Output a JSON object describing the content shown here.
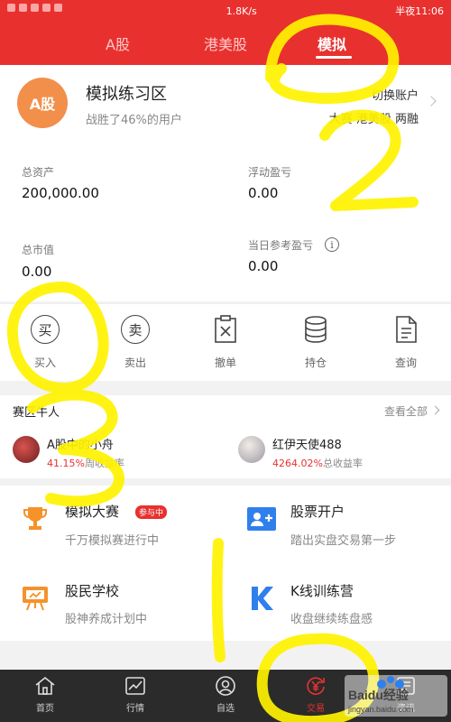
{
  "status_bar": {
    "speed": "1.8K/s",
    "time_text": "半夜11:06"
  },
  "top_tabs": [
    {
      "label": "A股"
    },
    {
      "label": "港美股"
    },
    {
      "label": "模拟"
    }
  ],
  "account": {
    "avatar_text": "A股",
    "title": "模拟练习区",
    "subtitle": "战胜了46%的用户",
    "switch_line1": "切换账户",
    "switch_line2": "大赛 港美股 两融",
    "total_assets_label": "总资产",
    "total_assets_value": "200,000.00",
    "floating_pl_label": "浮动盈亏",
    "floating_pl_value": "0.00",
    "market_value_label": "总市值",
    "market_value_value": "0.00",
    "today_pl_label": "当日参考盈亏",
    "today_pl_value": "0.00"
  },
  "actions": [
    {
      "label": "买入",
      "glyph": "买",
      "icon": "buy-icon"
    },
    {
      "label": "卖出",
      "glyph": "卖",
      "icon": "sell-icon"
    },
    {
      "label": "撤单",
      "icon": "cancel-order-icon"
    },
    {
      "label": "持仓",
      "icon": "position-icon"
    },
    {
      "label": "查询",
      "icon": "query-icon"
    }
  ],
  "bulls": {
    "title": "赛区牛人",
    "more": "查看全部",
    "items": [
      {
        "name": "A股中的小舟",
        "rate": "41.15%",
        "rate_label": "周收益率"
      },
      {
        "name": "红伊天使488",
        "rate": "4264.02%",
        "rate_label": "总收益率"
      }
    ]
  },
  "features": [
    {
      "title": "模拟大赛",
      "sub": "千万模拟赛进行中",
      "badge": "参与中",
      "icon": "trophy-icon"
    },
    {
      "title": "股票开户",
      "sub": "踏出实盘交易第一步",
      "icon": "open-account-icon"
    },
    {
      "title": "股民学校",
      "sub": "股神养成计划中",
      "icon": "school-icon"
    },
    {
      "title": "K线训练营",
      "sub": "收盘继续练盘感",
      "icon": "kline-icon"
    }
  ],
  "bottom_nav": [
    {
      "label": "首页"
    },
    {
      "label": "行情"
    },
    {
      "label": "自选"
    },
    {
      "label": "交易"
    },
    {
      "label": "资讯"
    }
  ],
  "watermark": "Baidu经验 jingyan.baidu.com",
  "colors": {
    "brand_red": "#e8312f",
    "avatar_orange": "#f28f4b",
    "icon_blue": "#2f80ed",
    "icon_orange": "#f5922a",
    "nav_bg": "#2b2b2b"
  }
}
